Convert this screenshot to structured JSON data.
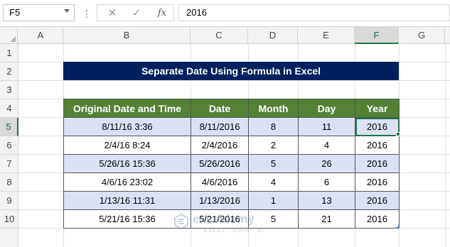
{
  "formula_bar": {
    "name_box": "F5",
    "cancel_icon": "✕",
    "enter_icon": "✓",
    "fx_icon": "fx",
    "value": "2016"
  },
  "columns": [
    "A",
    "B",
    "C",
    "D",
    "E",
    "F",
    "G"
  ],
  "active_column": "F",
  "rows": [
    "1",
    "2",
    "3",
    "4",
    "5",
    "6",
    "7",
    "8",
    "9",
    "10"
  ],
  "active_row": "5",
  "title": "Separate Date Using Formula in Excel",
  "table": {
    "headers": [
      "Original Date and Time",
      "Date",
      "Month",
      "Day",
      "Year"
    ],
    "rows": [
      [
        "8/11/16 3:36",
        "8/11/2016",
        "8",
        "11",
        "2016"
      ],
      [
        "2/4/16 8:24",
        "2/4/2016",
        "2",
        "4",
        "2016"
      ],
      [
        "5/26/16 15:36",
        "5/26/2016",
        "5",
        "26",
        "2016"
      ],
      [
        "4/6/16 23:02",
        "4/6/2016",
        "4",
        "6",
        "2016"
      ],
      [
        "1/13/16 11:31",
        "1/13/2016",
        "1",
        "13",
        "2016"
      ],
      [
        "5/21/16 15:36",
        "5/21/2016",
        "5",
        "21",
        "2016"
      ]
    ]
  },
  "watermark": {
    "name": "exceldemy",
    "tagline": "EXCEL · DATA · BI"
  },
  "colors": {
    "title_bg": "#002060",
    "header_bg": "#548235",
    "band_bg": "#d9e1f2",
    "selection": "#217346"
  }
}
